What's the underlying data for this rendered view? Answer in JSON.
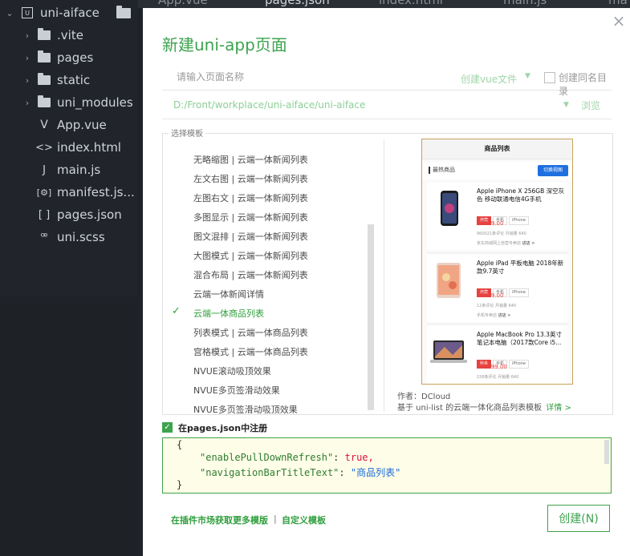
{
  "explorer": {
    "project": "uni-aiface",
    "items": [
      {
        "label": ".vite",
        "kind": "folder"
      },
      {
        "label": "pages",
        "kind": "folder"
      },
      {
        "label": "static",
        "kind": "folder"
      },
      {
        "label": "uni_modules",
        "kind": "folder"
      },
      {
        "label": "App.vue",
        "kind": "vue"
      },
      {
        "label": "index.html",
        "kind": "html"
      },
      {
        "label": "main.js",
        "kind": "js"
      },
      {
        "label": "manifest.js...",
        "kind": "json-config"
      },
      {
        "label": "pages.json",
        "kind": "json"
      },
      {
        "label": "uni.scss",
        "kind": "scss"
      }
    ]
  },
  "editor_tabs": [
    "App.vue",
    "pages.json",
    "index.html",
    "main.js",
    "ma"
  ],
  "dialog": {
    "title": "新建uni-app页面",
    "name_placeholder": "请输入页面名称",
    "file_type": "创建vue文件",
    "same_dir_label": "创建同名目录",
    "path": "D:/Front/workplace/uni-aiface/uni-aiface",
    "browse_label": "浏览",
    "template_legend": "选择模板",
    "templates": [
      {
        "label": "无略缩图 | 云端一体新闻列表",
        "selected": false
      },
      {
        "label": "左文右图 | 云端一体新闻列表",
        "selected": false
      },
      {
        "label": "左图右文 | 云端一体新闻列表",
        "selected": false
      },
      {
        "label": "多图显示 | 云端一体新闻列表",
        "selected": false
      },
      {
        "label": "图文混排 | 云端一体新闻列表",
        "selected": false
      },
      {
        "label": "大图模式 | 云端一体新闻列表",
        "selected": false
      },
      {
        "label": "混合布局 | 云端一体新闻列表",
        "selected": false
      },
      {
        "label": "云端一体新闻详情",
        "selected": false
      },
      {
        "label": "云端一体商品列表",
        "selected": true
      },
      {
        "label": "列表模式 | 云端一体商品列表",
        "selected": false
      },
      {
        "label": "宫格模式 | 云端一体商品列表",
        "selected": false
      },
      {
        "label": "NVUE滚动吸顶效果",
        "selected": false
      },
      {
        "label": "NVUE多页签滑动效果",
        "selected": false
      },
      {
        "label": "NVUE多页签滑动吸顶效果",
        "selected": false
      }
    ],
    "preview": {
      "header": "商品列表",
      "bar_title": "最热商品",
      "bar_button": "切换视图",
      "products": [
        {
          "name": "Apple iPhone X 256GB 深空灰色 移动联通电信4G手机",
          "tags": [
            "自营",
            "手机",
            "iPhone"
          ],
          "price": "¥9999.00",
          "meta": "960021条评论  月销量 640",
          "shop": "京东商城网上自营专卖店",
          "shop_link": "进店 >"
        },
        {
          "name": "Apple iPad 平板电脑 2018年新款9.7英寸",
          "tags": [
            "自营",
            "手机",
            "iPhone"
          ],
          "price": "¥3499.00",
          "meta": "12条评论  月销量 640",
          "shop": "手机专卖店",
          "shop_link": "进店 >"
        },
        {
          "name": "Apple MacBook Pro 13.3英寸笔记本电脑（2017款Core i5...",
          "tags": [
            "秒杀",
            "手机",
            "iPhone"
          ],
          "price": "¥12999.00",
          "meta": "156条评论  月销量 640",
          "shop": "",
          "shop_link": ""
        }
      ]
    },
    "author": "作者：DCloud",
    "description": "基于 uni-list 的云端一体化商品列表模板",
    "details_link": "详情 >",
    "register_label": "在pages.json中注册",
    "code": {
      "open": "{",
      "line1_key": "\"enablePullDownRefresh\"",
      "line1_val": "true,",
      "line2_key": "\"navigationBarTitleText\"",
      "line2_val": "\"商品列表\"",
      "close": "}"
    },
    "link_market": "在插件市场获取更多模版",
    "link_separator": "|",
    "link_custom": "自定义模板",
    "create_label": "创建(N)",
    "accent": "#3ea34f"
  }
}
